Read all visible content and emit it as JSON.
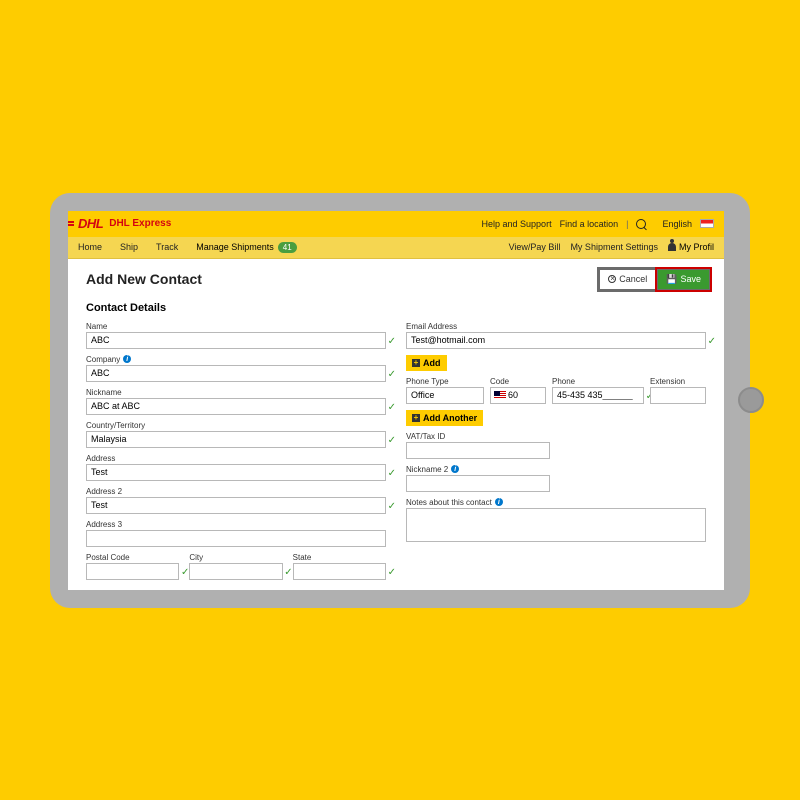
{
  "header": {
    "logo_text": "DHL",
    "product_name": "DHL Express",
    "help": "Help and Support",
    "find": "Find a location",
    "language": "English"
  },
  "nav": {
    "items": [
      "Home",
      "Ship",
      "Track",
      "Manage Shipments"
    ],
    "badge": "41",
    "right": [
      "View/Pay Bill",
      "My Shipment Settings",
      "My Profil"
    ]
  },
  "page": {
    "title": "Add New Contact",
    "cancel": "Cancel",
    "save": "Save",
    "section": "Contact Details"
  },
  "left": {
    "name_label": "Name",
    "name_value": "ABC",
    "company_label": "Company",
    "company_value": "ABC",
    "nickname_label": "Nickname",
    "nickname_value": "ABC at ABC",
    "country_label": "Country/Territory",
    "country_value": "Malaysia",
    "address_label": "Address",
    "address_value": "Test",
    "address2_label": "Address 2",
    "address2_value": "Test",
    "address3_label": "Address 3",
    "address3_value": "",
    "postal_label": "Postal Code",
    "city_label": "City",
    "state_label": "State"
  },
  "right": {
    "email_label": "Email Address",
    "email_value": "Test@hotmail.com",
    "add": "Add",
    "phone_type_label": "Phone Type",
    "phone_type_value": "Office",
    "code_label": "Code",
    "code_value": "60",
    "phone_label": "Phone",
    "phone_value": "45-435 435______",
    "ext_label": "Extension",
    "ext_value": "",
    "add_another": "Add Another",
    "vat_label": "VAT/Tax ID",
    "nickname2_label": "Nickname 2",
    "notes_label": "Notes about this contact"
  }
}
